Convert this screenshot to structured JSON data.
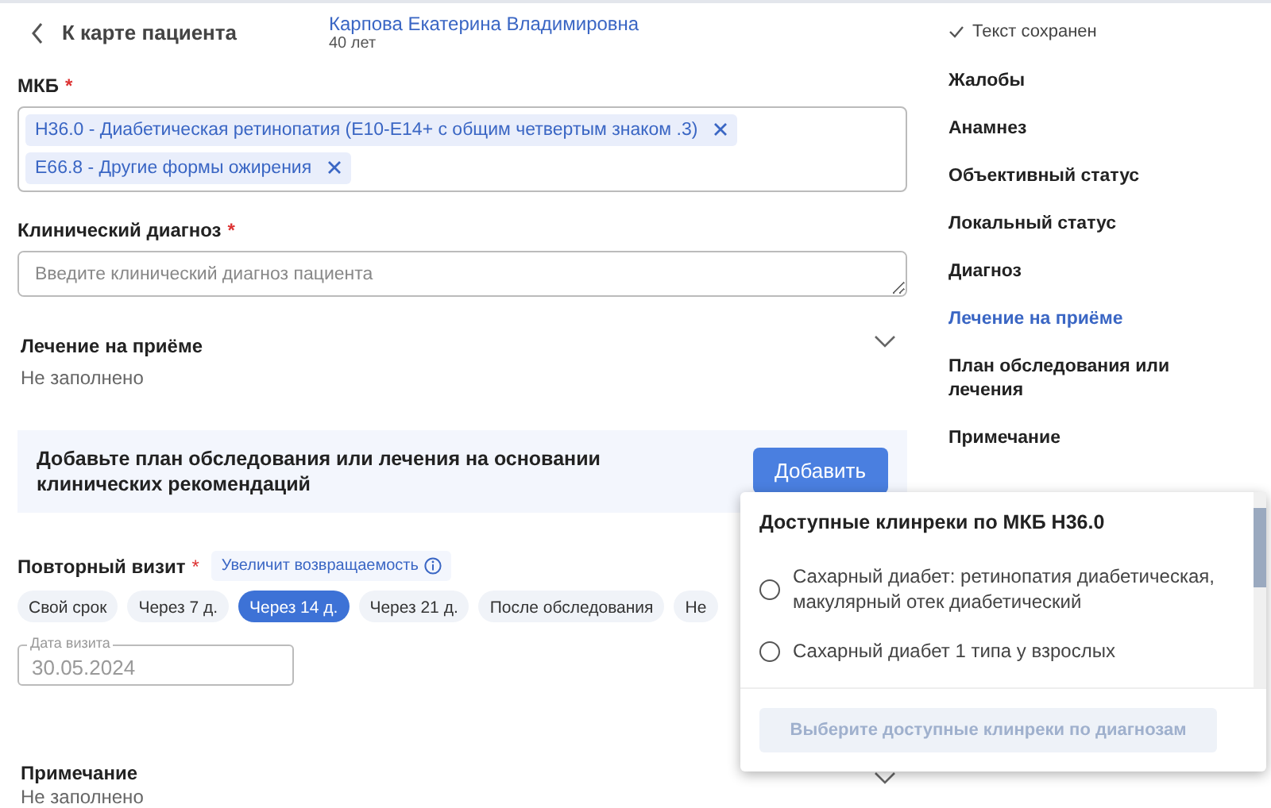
{
  "header": {
    "back_label": "К карте пациента",
    "patient_name": "Карпова Екатерина Владимировна",
    "patient_age": "40 лет",
    "save_status": "Текст сохранен"
  },
  "icd": {
    "label": "МКБ",
    "required_mark": "*",
    "tags": [
      {
        "text": "H36.0 - Диабетическая ретинопатия (E10-E14+ с общим четвертым знаком .3)"
      },
      {
        "text": "E66.8 - Другие формы ожирения"
      }
    ]
  },
  "clinical_diagnosis": {
    "label": "Клинический диагноз",
    "required_mark": "*",
    "placeholder": "Введите клинический диагноз пациента"
  },
  "treatment": {
    "title": "Лечение на приёме",
    "value": "Не заполнено",
    "expanded": false
  },
  "banner": {
    "text": "Добавьте план обследования или лечения на основании клинических рекомендаций",
    "button": "Добавить"
  },
  "repeat_visit": {
    "label": "Повторный визит",
    "required_mark": "*",
    "hint": "Увеличит возвращаемость",
    "options": [
      {
        "label": "Свой срок",
        "selected": false
      },
      {
        "label": "Через 7 д.",
        "selected": false
      },
      {
        "label": "Через 14 д.",
        "selected": true
      },
      {
        "label": "Через 21 д.",
        "selected": false
      },
      {
        "label": "После обследования",
        "selected": false
      },
      {
        "label": "Не",
        "selected": false
      }
    ],
    "date_label": "Дата визита",
    "date_value": "30.05.2024"
  },
  "note": {
    "title": "Примечание",
    "value": "Не заполнено",
    "expanded": false
  },
  "sidebar": {
    "items": [
      {
        "label": "Жалобы",
        "selected": false
      },
      {
        "label": "Анамнез",
        "selected": false
      },
      {
        "label": "Объективный статус",
        "selected": false
      },
      {
        "label": "Локальный статус",
        "selected": false
      },
      {
        "label": "Диагноз",
        "selected": false
      },
      {
        "label": "Лечение на приёме",
        "selected": true
      },
      {
        "label": "План обследования или лечения",
        "selected": false
      },
      {
        "label": "Примечание",
        "selected": false
      }
    ]
  },
  "popup": {
    "title": "Доступные клинреки по МКБ H36.0",
    "options": [
      {
        "label": "Сахарный диабет: ретинопатия диабетическая, макулярный отек диабетический",
        "selected": false
      },
      {
        "label": "Сахарный диабет 1 типа у взрослых",
        "selected": false
      }
    ],
    "button": {
      "label": "Выберите доступные клинреки по диагнозам",
      "disabled": true
    }
  }
}
